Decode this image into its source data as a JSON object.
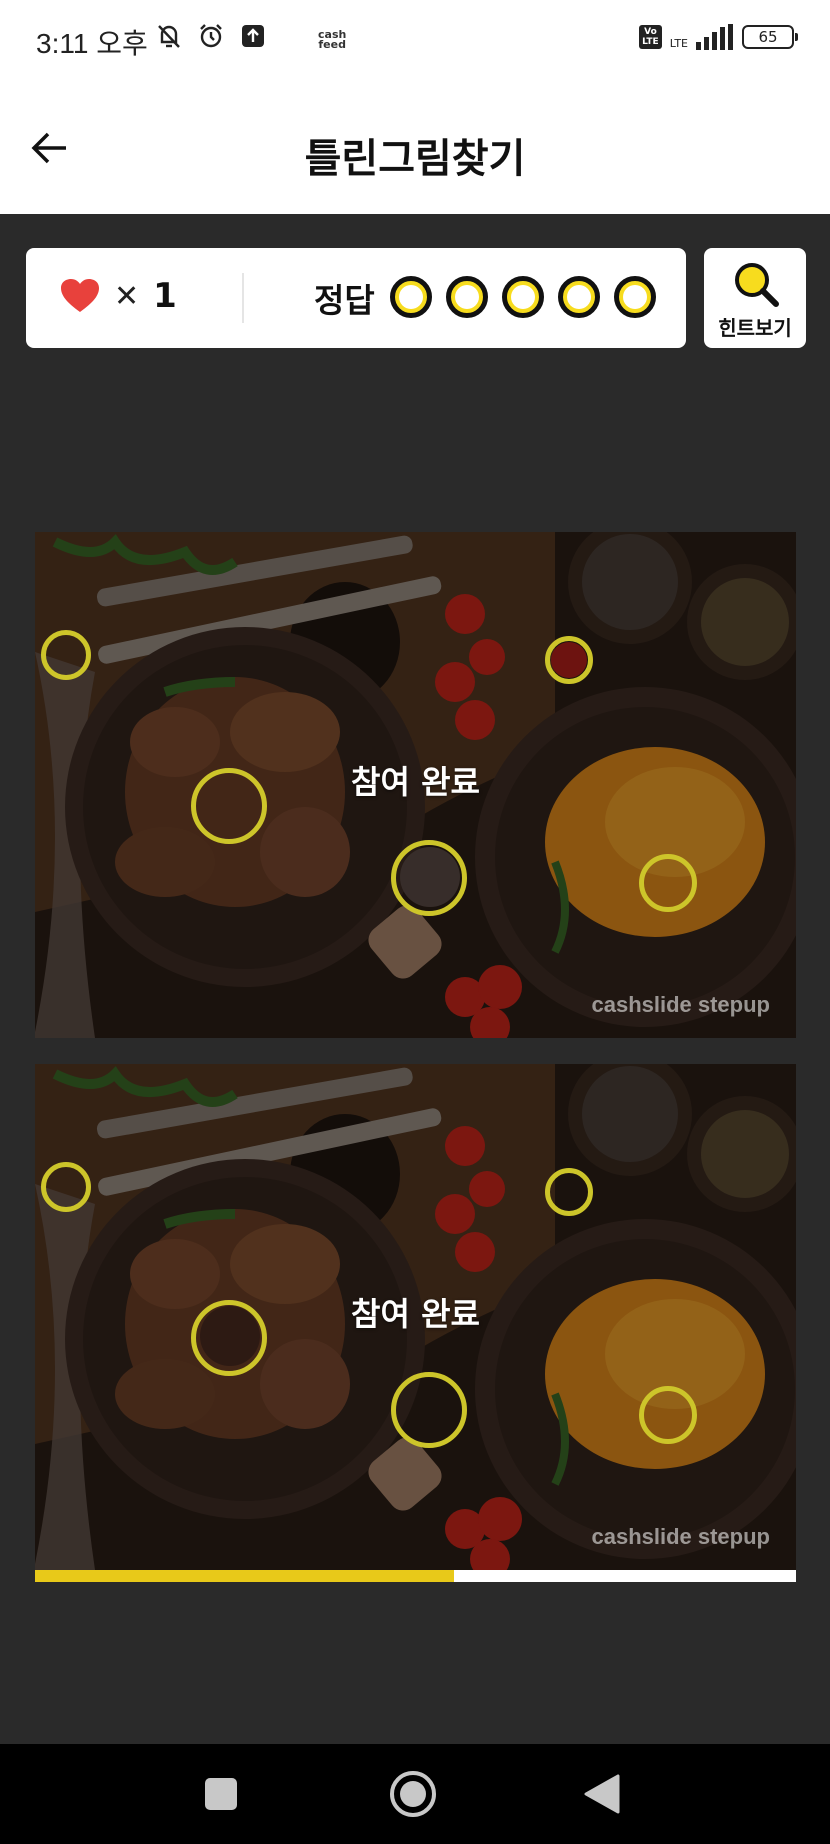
{
  "status_bar": {
    "time": "3:11 오후",
    "cashfeed_logo_line1": "cash",
    "cashfeed_logo_line2": "feed",
    "volte_line1": "Vo",
    "volte_line2": "LTE",
    "lte": "LTE",
    "battery": "65"
  },
  "header": {
    "title": "틀린그림찾기",
    "back_icon": "arrow-left-icon"
  },
  "info": {
    "lives_icon": "heart-icon",
    "lives_separator": "✕",
    "lives_count": "1",
    "answer_label": "정답",
    "answer_slots": 5,
    "hint_label": "힌트보기",
    "hint_icon": "magnifier-icon"
  },
  "puzzle": {
    "done_text": "참여 완료",
    "watermark": "cashslide stepup"
  },
  "progress": {
    "fraction": 0.55
  },
  "colors": {
    "accent_yellow": "#e8c919",
    "marker": "#cdc52a",
    "background": "#2a2a2a",
    "heart": "#e8413c"
  },
  "nav": {
    "recent_icon": "square-icon",
    "home_icon": "circle-home-icon",
    "back_icon": "triangle-back-icon"
  }
}
